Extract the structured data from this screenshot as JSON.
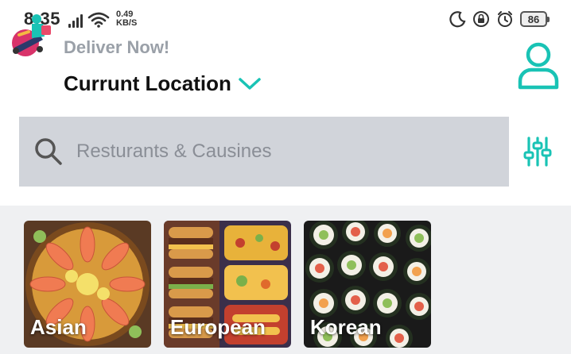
{
  "status_bar": {
    "time": "8:35",
    "speed_value": "0.49",
    "speed_unit": "KB/S",
    "battery": "86",
    "icons": [
      "signal-icon",
      "wifi-icon",
      "moon-icon",
      "screen-lock-icon",
      "alarm-icon",
      "battery-icon"
    ]
  },
  "header": {
    "deliver_label": "Deliver Now!",
    "location_label": "Currunt Location",
    "icons": [
      "delivery-logo-icon",
      "chevron-down-icon",
      "user-profile-icon"
    ]
  },
  "search": {
    "placeholder": "Resturants & Causines",
    "icons": [
      "search-icon",
      "filter-sliders-icon"
    ]
  },
  "categories": [
    {
      "label": "Asian"
    },
    {
      "label": "European"
    },
    {
      "label": "Korean"
    }
  ],
  "colors": {
    "accent": "#19c3b5",
    "search_bg": "#d1d4da",
    "section_bg": "#eff0f2",
    "muted_text": "#9aa0a8"
  }
}
